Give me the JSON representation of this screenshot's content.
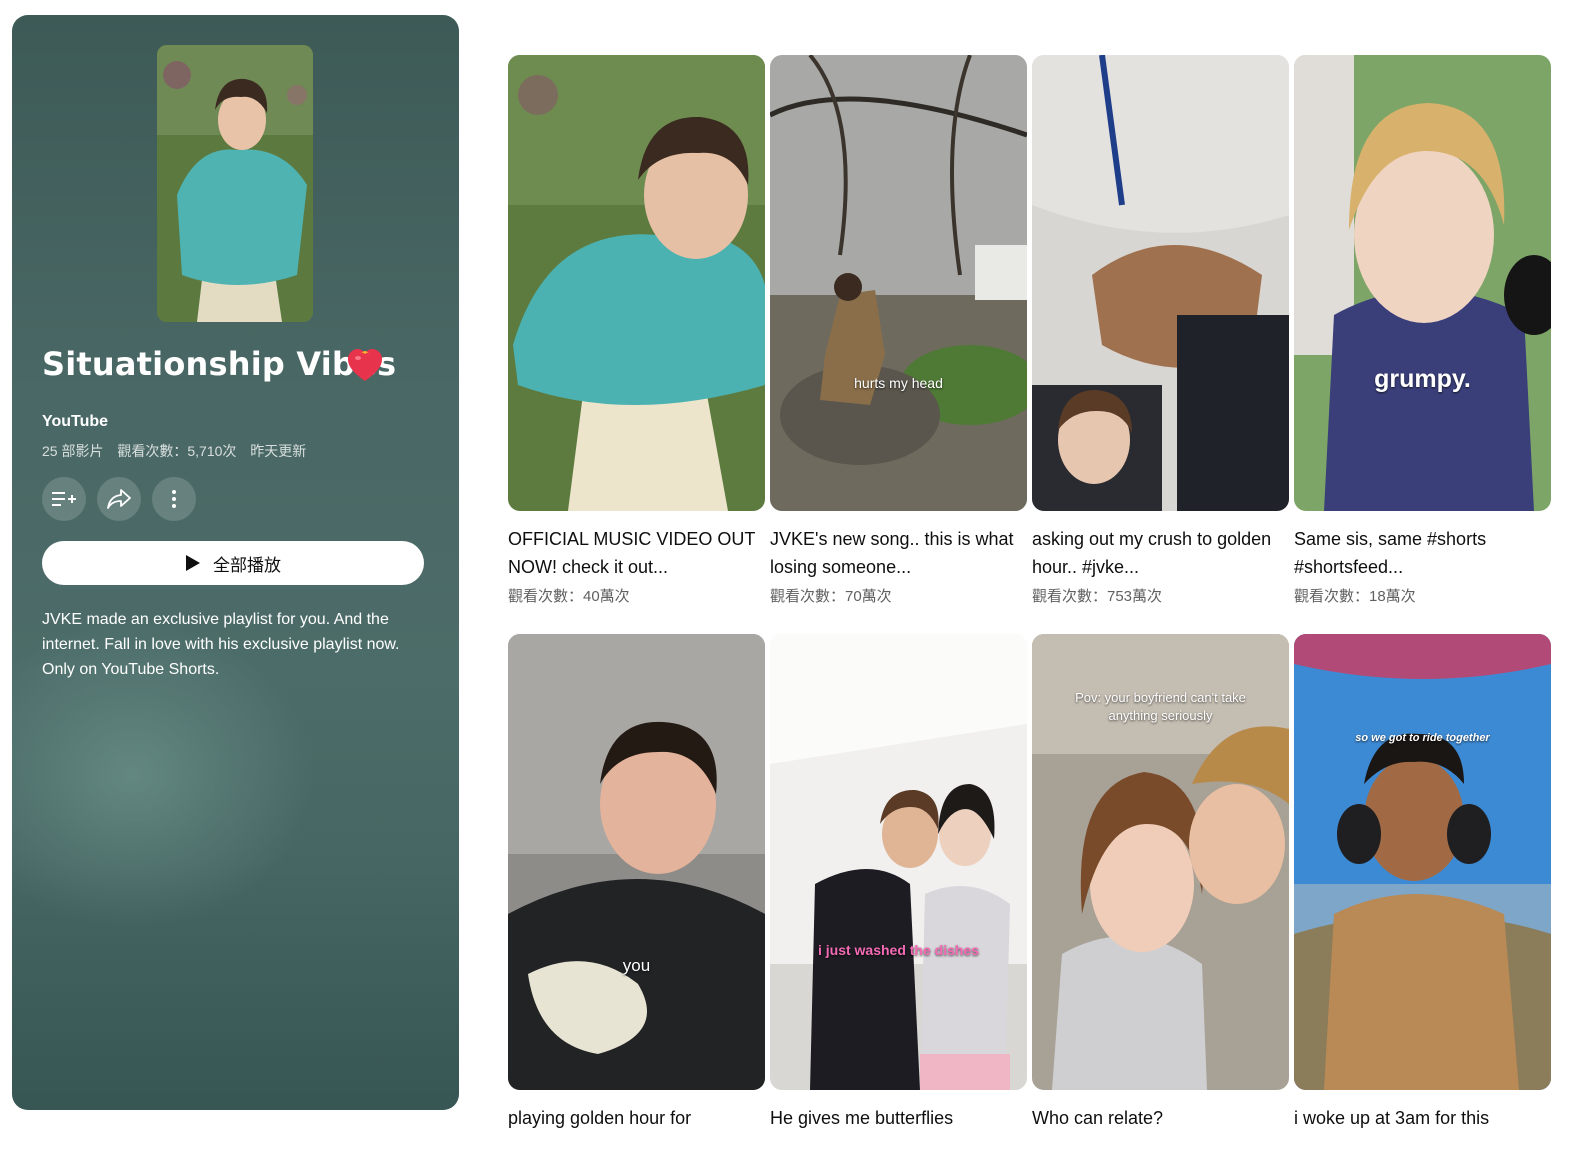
{
  "playlist": {
    "title": "Situationship Vibes",
    "title_emoji_icon": "heart-on-fire-icon",
    "channel": "YouTube",
    "video_count": "25 部影片",
    "view_count": "觀看次數：5,710次",
    "updated": "昨天更新",
    "play_all_label": "全部播放",
    "description": "JVKE made an exclusive playlist for you. And the internet. Fall in love with his exclusive playlist now. Only on YouTube Shorts.",
    "actions": [
      "save-to-library-icon",
      "share-icon",
      "more-vert-icon"
    ],
    "panel_color": "#4a6865"
  },
  "videos": [
    {
      "title": "OFFICIAL MUSIC VIDEO OUT NOW! check it out...",
      "views": "觀看次數：40萬次",
      "caption": ""
    },
    {
      "title": "JVKE's new song.. this is what losing someone...",
      "views": "觀看次數：70萬次",
      "caption": "hurts my head"
    },
    {
      "title": "asking out my crush to golden hour.. #jvke...",
      "views": "觀看次數：753萬次",
      "caption": ""
    },
    {
      "title": "Same sis, same #shorts #shortsfeed...",
      "views": "觀看次數：18萬次",
      "caption": "grumpy."
    },
    {
      "title": "playing golden hour for",
      "views": "",
      "caption": "you"
    },
    {
      "title": "He gives me butterflies",
      "views": "",
      "caption": "i just washed the dishes"
    },
    {
      "title": "Who can relate?",
      "views": "",
      "caption": "Pov: your boyfriend can't take anything seriously"
    },
    {
      "title": "i woke up at 3am for this",
      "views": "",
      "caption": "so we got to ride together"
    }
  ]
}
